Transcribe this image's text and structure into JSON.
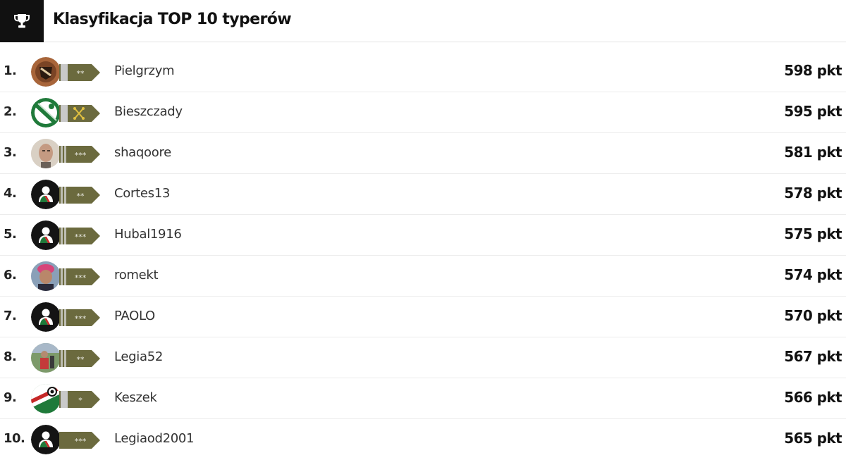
{
  "header": {
    "title": "Klasyfikacja TOP 10 typerów",
    "icon": "trophy-icon"
  },
  "colors": {
    "badge_olive": "#6b6a3e",
    "header_box": "#111111",
    "legia_green": "#1f7a3a"
  },
  "rows": [
    {
      "rank": "1.",
      "name": "Pielgrzym",
      "points": "598 pkt",
      "avatar": "avatar-crest-bronze",
      "badge_stars": "**",
      "badge_type": "silver-stripe"
    },
    {
      "rank": "2.",
      "name": "Bieszczady",
      "points": "595 pkt",
      "avatar": "avatar-legia-green",
      "badge_stars": "",
      "badge_type": "crossed-batons"
    },
    {
      "rank": "3.",
      "name": "shaqoore",
      "points": "581 pkt",
      "avatar": "avatar-photo-face",
      "badge_stars": "***",
      "badge_type": "double-stripe"
    },
    {
      "rank": "4.",
      "name": "Cortes13",
      "points": "578 pkt",
      "avatar": "avatar-default",
      "badge_stars": "**",
      "badge_type": "double-stripe"
    },
    {
      "rank": "5.",
      "name": "Hubal1916",
      "points": "575 pkt",
      "avatar": "avatar-default",
      "badge_stars": "***",
      "badge_type": "double-stripe"
    },
    {
      "rank": "6.",
      "name": "romekt",
      "points": "574 pkt",
      "avatar": "avatar-photo-pink",
      "badge_stars": "***",
      "badge_type": "double-stripe"
    },
    {
      "rank": "7.",
      "name": "PAOLO",
      "points": "570 pkt",
      "avatar": "avatar-default",
      "badge_stars": "***",
      "badge_type": "double-stripe"
    },
    {
      "rank": "8.",
      "name": "Legia52",
      "points": "567 pkt",
      "avatar": "avatar-photo-outdoor",
      "badge_stars": "**",
      "badge_type": "double-stripe"
    },
    {
      "rank": "9.",
      "name": "Keszek",
      "points": "566 pkt",
      "avatar": "avatar-legia-flag",
      "badge_stars": "*",
      "badge_type": "single-stripe"
    },
    {
      "rank": "10.",
      "name": "Legiaod2001",
      "points": "565 pkt",
      "avatar": "avatar-default",
      "badge_stars": "***",
      "badge_type": "plain"
    }
  ]
}
